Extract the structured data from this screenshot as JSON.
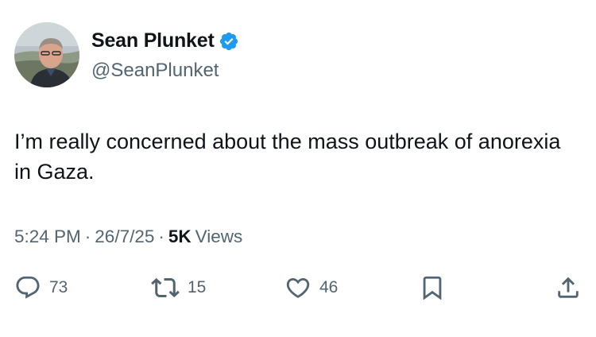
{
  "author": {
    "display_name": "Sean Plunket",
    "handle": "@SeanPlunket",
    "verified": true,
    "verified_color": "#1d9bf0"
  },
  "tweet": {
    "text": "I’m really concerned about the mass outbreak of anorexia in Gaza."
  },
  "meta": {
    "time": "5:24 PM",
    "separator": "·",
    "date": "26/7/25",
    "views_count": "5K",
    "views_label": "Views"
  },
  "actions": {
    "replies": {
      "icon": "reply-icon",
      "count": "73"
    },
    "retweets": {
      "icon": "retweet-icon",
      "count": "15"
    },
    "likes": {
      "icon": "heart-icon",
      "count": "46"
    },
    "bookmark": {
      "icon": "bookmark-icon"
    },
    "share": {
      "icon": "share-icon"
    }
  },
  "colors": {
    "text_primary": "#0f1419",
    "text_secondary": "#536471",
    "icon": "#536471"
  }
}
